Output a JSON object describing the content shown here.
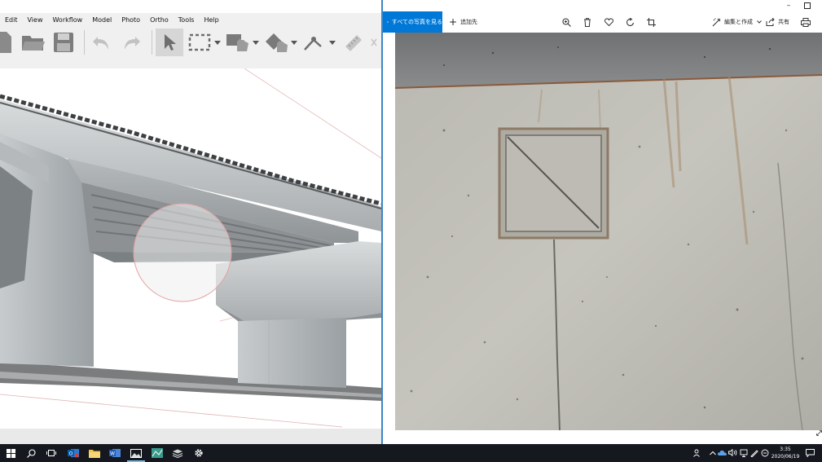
{
  "left_app": {
    "menu": [
      "Edit",
      "View",
      "Workflow",
      "Model",
      "Photo",
      "Ortho",
      "Tools",
      "Help"
    ],
    "toolbar_tools": [
      "new",
      "open",
      "save",
      "undo",
      "redo",
      "navigation",
      "rectangle-selection",
      "move-object",
      "rotate-object",
      "ruler",
      "measure"
    ]
  },
  "photos_app": {
    "see_all_label": "すべての写真を見る",
    "add_to_label": "追加先",
    "edit_create_label": "編集と作成",
    "share_label": "共有"
  },
  "taskbar": {
    "apps": [
      "start",
      "search",
      "task-view",
      "outlook",
      "file-explorer",
      "word",
      "photos",
      "3d-scan-app",
      "cloud-app",
      "settings"
    ],
    "clock_time": "3:35",
    "clock_date": "2020/06/19"
  },
  "colors": {
    "accent": "#0078d7",
    "taskbar_bg": "#15191f",
    "window_divider": "#3a86c9",
    "toolbar_bg": "#f0f0f0"
  }
}
